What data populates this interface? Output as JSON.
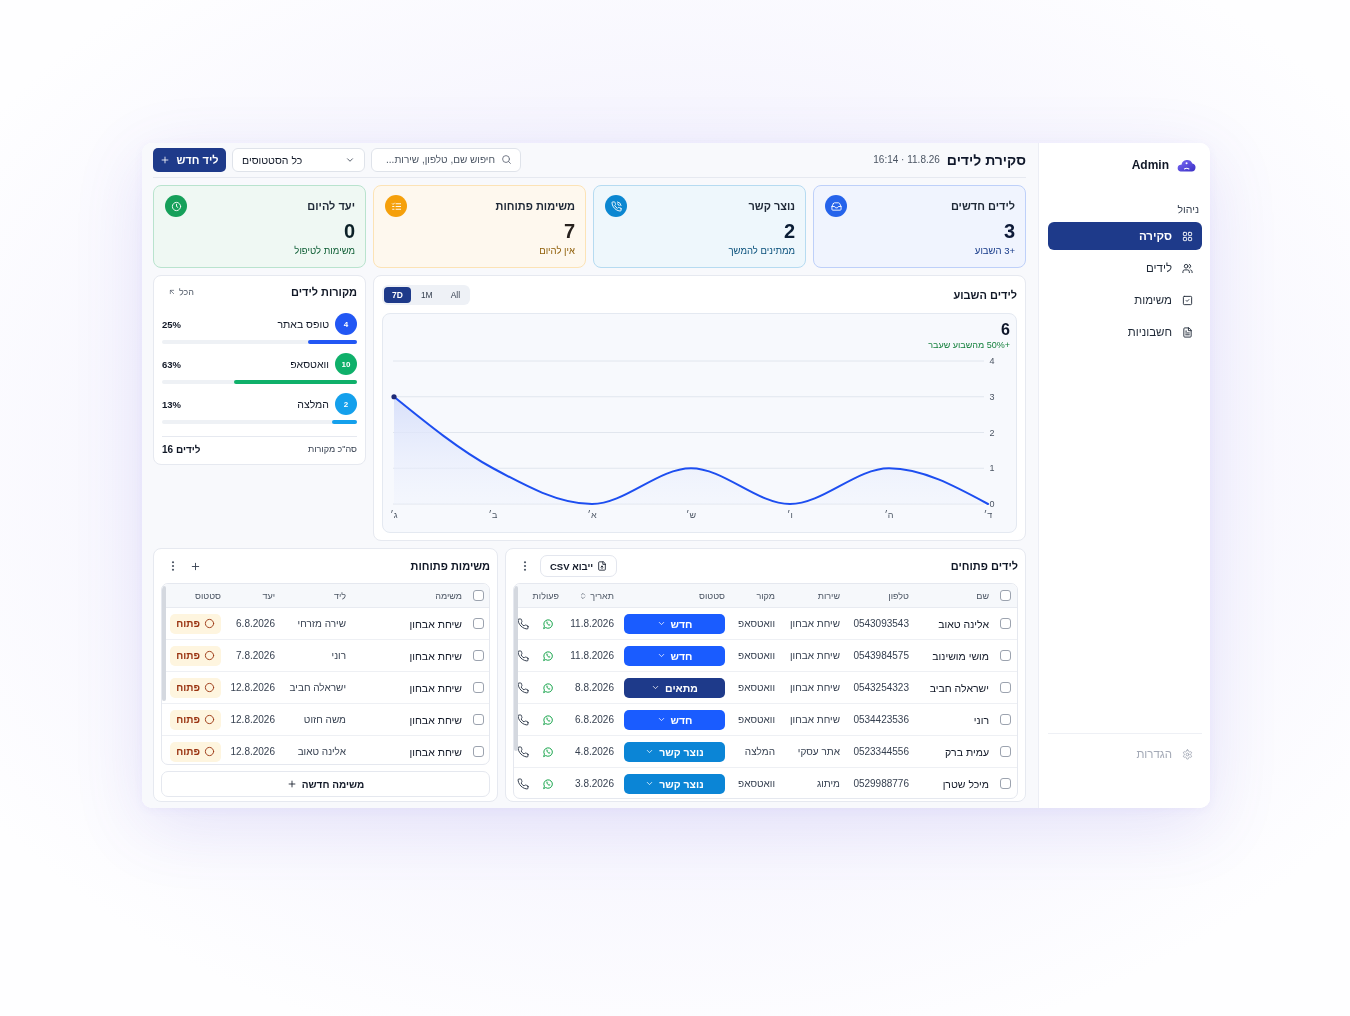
{
  "sidebar": {
    "brand": "Admin",
    "section_label": "ניהול",
    "items": [
      {
        "label": "סקירה",
        "selected": true
      },
      {
        "label": "לידים",
        "selected": false
      },
      {
        "label": "משימות",
        "selected": false
      },
      {
        "label": "חשבוניות",
        "selected": false
      }
    ],
    "footer_item": {
      "label": "הגדרות",
      "disabled": true
    }
  },
  "header": {
    "title": "סקירת לידים",
    "timestamp": "11.8.26 · 16:14",
    "search": {
      "placeholder": "חיפוש שם, טלפון, שירות..."
    },
    "status_filter": "כל הסטטוסים",
    "new_lead_button": "ליד חדש"
  },
  "stat_cards": [
    {
      "title": "לידים חדשים",
      "value": "3",
      "note": "+3 השבוע",
      "color": "#2563eb"
    },
    {
      "title": "נוצר קשר",
      "value": "2",
      "note": "ממתינים להמשך",
      "color": "#0b87d1"
    },
    {
      "title": "משימות פתוחות",
      "value": "7",
      "note": "אין להיום",
      "color": "#f5a00b"
    },
    {
      "title": "יעד להיום",
      "value": "0",
      "note": "משימות לטיפול",
      "color": "#16a05a"
    }
  ],
  "weekly_leads": {
    "title": "לידים השבוע",
    "ranges": [
      {
        "label": "All",
        "selected": false
      },
      {
        "label": "1M",
        "selected": false
      },
      {
        "label": "7D",
        "selected": true
      }
    ],
    "total": "6",
    "change": "+50% מהשבוע שעבר",
    "chart_data": {
      "type": "area",
      "categories": [
        "ג׳",
        "ב׳",
        "א׳",
        "ש׳",
        "ו׳",
        "ה׳",
        "ד׳"
      ],
      "values": [
        3,
        1,
        0,
        1,
        0,
        1,
        0
      ],
      "ylim": [
        0,
        4
      ],
      "yticks": [
        0,
        1,
        2,
        3,
        4
      ],
      "grid": true
    }
  },
  "lead_sources": {
    "title": "מקורות לידים",
    "view_all": "הכל",
    "items": [
      {
        "name": "טופס באתר",
        "count": "4",
        "percent": "25%",
        "level": 0.25,
        "color": "#2257f4"
      },
      {
        "name": "וואטסאפ",
        "count": "10",
        "percent": "63%",
        "level": 0.63,
        "color": "#0fb06a"
      },
      {
        "name": "המלצה",
        "count": "2",
        "percent": "13%",
        "level": 0.13,
        "color": "#14a0ec"
      }
    ],
    "total_label": "סה\"כ מקורות",
    "total_value": "16 לידים"
  },
  "open_leads": {
    "title": "לידים פתוחים",
    "import_button": "ייבוא CSV",
    "select_all_checked": false,
    "columns": [
      {
        "label": "שם",
        "sortable": false
      },
      {
        "label": "טלפון",
        "sortable": false
      },
      {
        "label": "שירות",
        "sortable": false
      },
      {
        "label": "מקור",
        "sortable": false
      },
      {
        "label": "סטטוס",
        "sortable": false
      },
      {
        "label": "תאריך",
        "sortable": true
      },
      {
        "label": "פעולות",
        "sortable": false
      }
    ],
    "rows": [
      {
        "checked": false,
        "name": "אלינה טאוב",
        "phone": "0543093543",
        "service": "שיחת אבחון",
        "source": "וואטסאפ",
        "status": {
          "label": "חדש",
          "color": "#1a5cff"
        },
        "date": "11.8.2026"
      },
      {
        "checked": false,
        "name": "מושי מושינוב",
        "phone": "0543984575",
        "service": "שיחת אבחון",
        "source": "וואטסאפ",
        "status": {
          "label": "חדש",
          "color": "#1a5cff"
        },
        "date": "11.8.2026"
      },
      {
        "checked": false,
        "name": "ישראלה חביב",
        "phone": "0543254323",
        "service": "שיחת אבחון",
        "source": "וואטסאפ",
        "status": {
          "label": "מתאים",
          "color": "#1e3a8a"
        },
        "date": "8.8.2026"
      },
      {
        "checked": false,
        "name": "רוני",
        "phone": "0534423536",
        "service": "שיחת אבחון",
        "source": "וואטסאפ",
        "status": {
          "label": "חדש",
          "color": "#1a5cff"
        },
        "date": "6.8.2026"
      },
      {
        "checked": false,
        "name": "עמית ברק",
        "phone": "0523344556",
        "service": "אתר עסקי",
        "source": "המלצה",
        "status": {
          "label": "נוצר קשר",
          "color": "#0b85d6"
        },
        "date": "4.8.2026"
      },
      {
        "checked": false,
        "name": "מיכל שטרן",
        "phone": "0529988776",
        "service": "מיתוג",
        "source": "וואטסאפ",
        "status": {
          "label": "נוצר קשר",
          "color": "#0b85d6"
        },
        "date": "3.8.2026"
      }
    ]
  },
  "open_tasks": {
    "title": "משימות פתוחות",
    "select_all_checked": false,
    "columns": [
      "משימה",
      "ליד",
      "יעד",
      "סטטוס"
    ],
    "rows": [
      {
        "checked": false,
        "task": "שיחת אבחון",
        "lead": "שירה מזרחי",
        "due": "6.8.2026",
        "status": "פתוח"
      },
      {
        "checked": false,
        "task": "שיחת אבחון",
        "lead": "רוני",
        "due": "7.8.2026",
        "status": "פתוח"
      },
      {
        "checked": false,
        "task": "שיחת אבחון",
        "lead": "ישראלה חביב",
        "due": "12.8.2026",
        "status": "פתוח"
      },
      {
        "checked": false,
        "task": "שיחת אבחון",
        "lead": "משה חזוט",
        "due": "12.8.2026",
        "status": "פתוח"
      },
      {
        "checked": false,
        "task": "שיחת אבחון",
        "lead": "אלינה טאוב",
        "due": "12.8.2026",
        "status": "פתוח"
      }
    ],
    "new_task_button": "משימה חדשה"
  }
}
